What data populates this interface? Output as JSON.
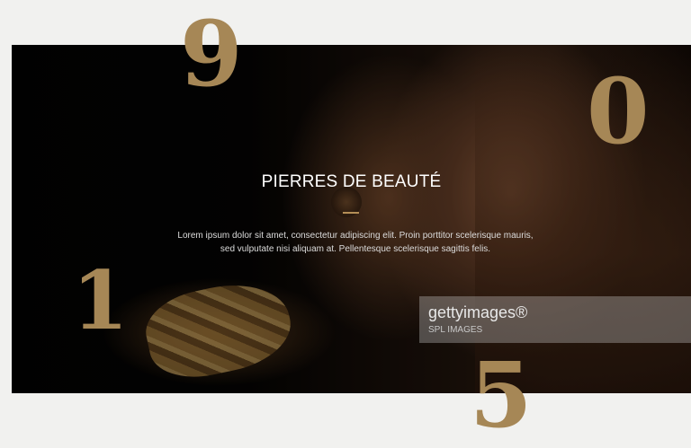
{
  "hero": {
    "title": "PIERRES DE BEAUTÉ",
    "description": "Lorem ipsum dolor sit amet, consectetur adipiscing elit. Proin porttitor scelerisque mauris, sed vulputate nisi aliquam at. Pellentesque scelerisque sagittis felis."
  },
  "watermark": {
    "logo": "gettyimages®",
    "credit": "SPL IMAGES"
  },
  "decorative_numbers": {
    "n9": "9",
    "n0": "0",
    "n1": "1",
    "n5": "5"
  },
  "colors": {
    "page_background": "#f1f1ef",
    "accent_gold": "#a68756",
    "hero_background": "#000000"
  }
}
